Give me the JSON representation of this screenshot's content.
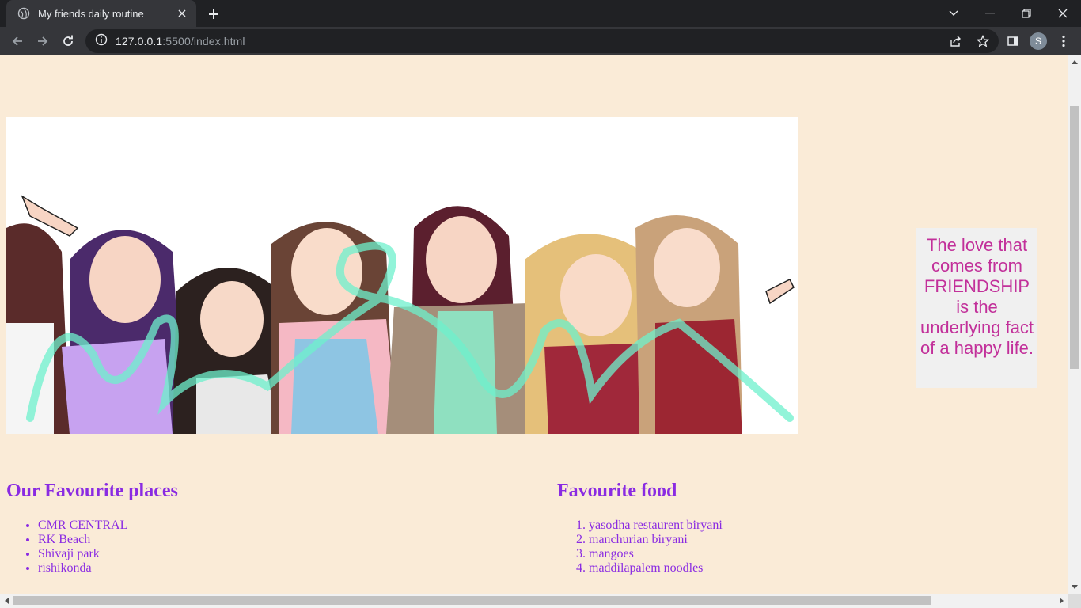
{
  "browser": {
    "tab_title": "My friends daily routine",
    "url_host": "127.0.0.1",
    "url_rest": ":5500/index.html",
    "profile_initial": "S"
  },
  "page": {
    "quote": "The love that comes from FRIENDSHIP is the underlying fact of a happy life.",
    "places": {
      "heading": "Our Favourite places",
      "items": [
        "CMR CENTRAL",
        "RK Beach",
        "Shivaji park",
        "rishikonda"
      ]
    },
    "food": {
      "heading": "Favourite food",
      "items": [
        "yasodha restaurent biryani",
        "manchurian biryani",
        "mangoes",
        "maddilapalem noodles"
      ]
    },
    "colors": {
      "background": "#faebd7",
      "heading": "#8a2be2",
      "quote_text": "#c2309a",
      "quote_bg": "#f0f0f0"
    }
  }
}
